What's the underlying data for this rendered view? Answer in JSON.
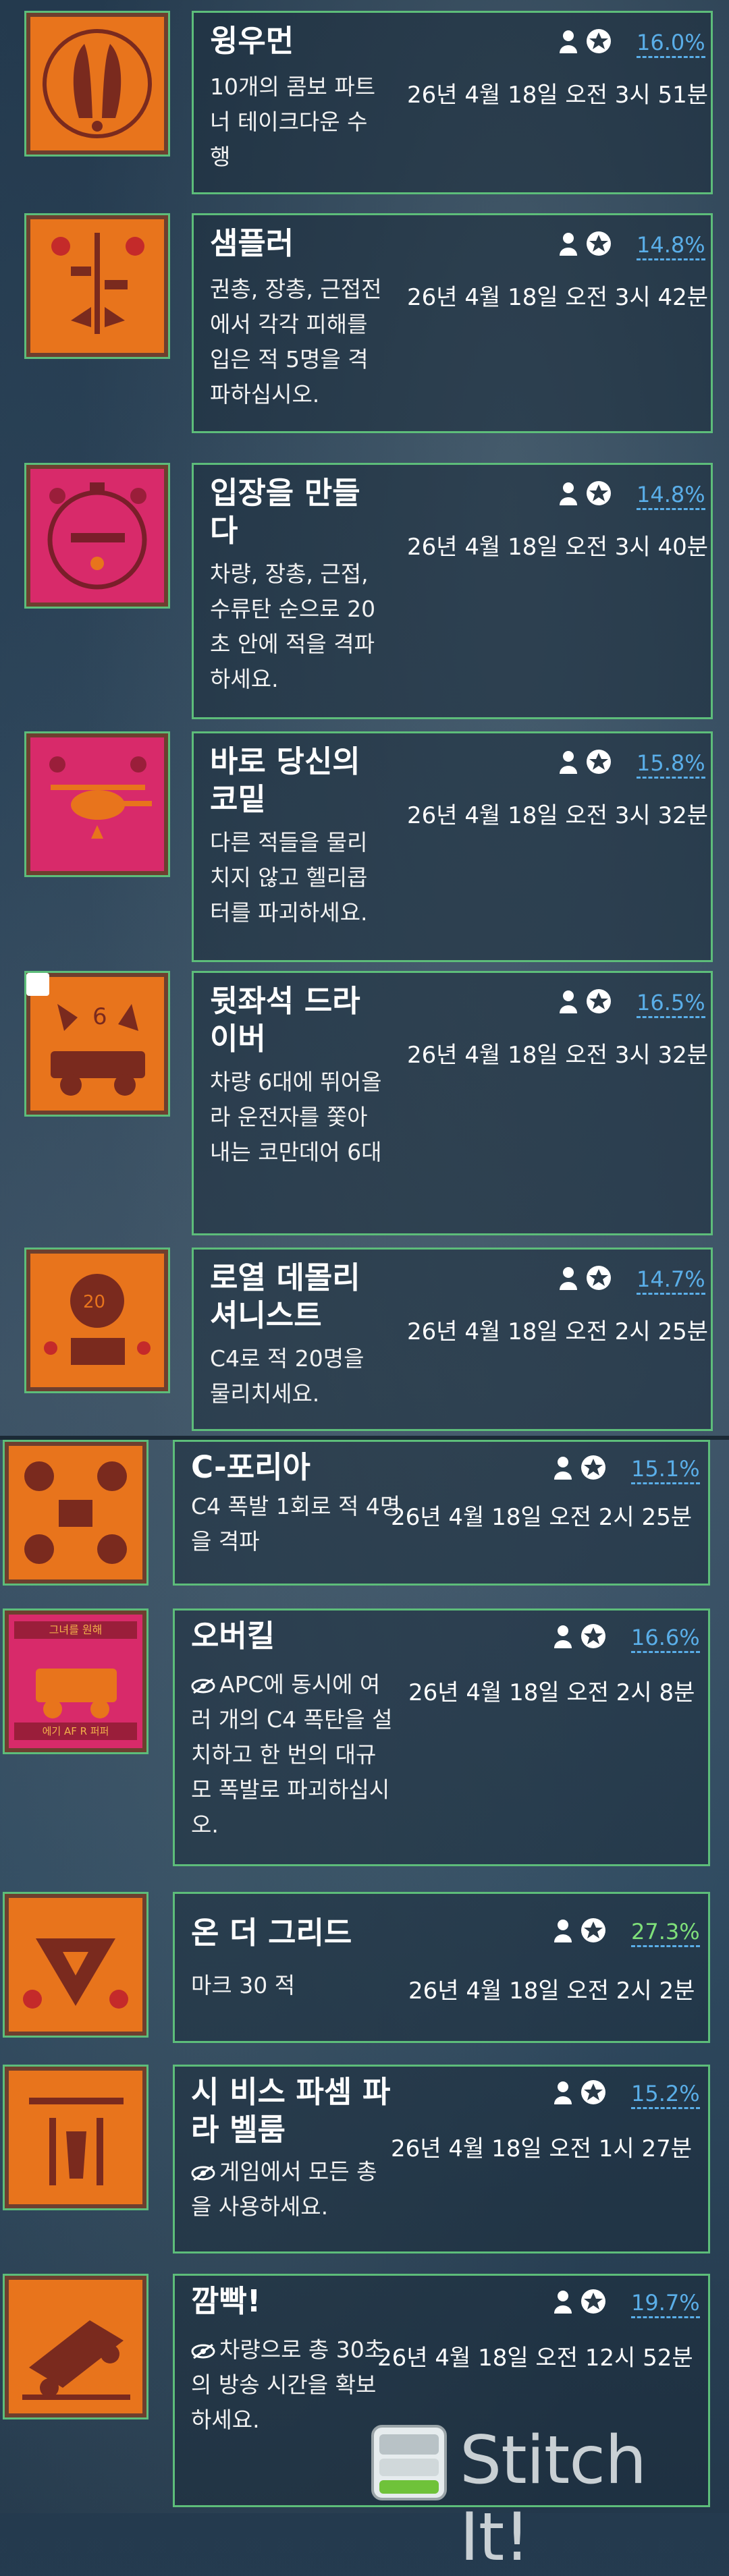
{
  "achievements": [
    {
      "title": "윙우먼",
      "desc": "10개의 콤보 파트너 테이크다운 수행",
      "date": "26년 4월 18일 오전 3시 51분",
      "pct": "16.0%",
      "thumb_bg": "#e8741c",
      "frame": "#7a4a2a"
    },
    {
      "title": "샘플러",
      "desc": "권총, 장총, 근접전에서 각각 피해를 입은 적 5명을 격파하십시오.",
      "date": "26년 4월 18일 오전 3시 42분",
      "pct": "14.8%",
      "thumb_bg": "#e8741c",
      "frame": "#7a4a2a"
    },
    {
      "title": "입장을 만들다",
      "desc": "차량, 장총, 근접, 수류탄 순으로 20초 안에 적을 격파하세요.",
      "date": "26년 4월 18일 오전 3시 40분",
      "pct": "14.8%",
      "thumb_bg": "#d82a6a",
      "frame": "#7a2a4a"
    },
    {
      "title": "바로 당신의 코밑",
      "desc": "다른 적들을 물리치지 않고 헬리콥터를 파괴하세요.",
      "date": "26년 4월 18일 오전 3시 32분",
      "pct": "15.8%",
      "thumb_bg": "#d82a6a",
      "frame": "#7a2a4a"
    },
    {
      "title": "뒷좌석 드라이버",
      "desc": "차량 6대에 뛰어올라 운전자를 쫓아내는 코만데어 6대",
      "date": "26년 4월 18일 오전 3시 32분",
      "pct": "16.5%",
      "thumb_bg": "#e8741c",
      "frame": "#7a4a2a"
    },
    {
      "title": "로열 데몰리셔니스트",
      "desc": "C4로 적 20명을 물리치세요.",
      "date": "26년 4월 18일 오전 2시 25분",
      "pct": "14.7%",
      "thumb_bg": "#e8741c",
      "frame": "#7a4a2a"
    },
    {
      "title": "C-포리아",
      "desc": "C4 폭발 1회로 적 4명을 격파",
      "date": "26년 4월 18일 오전 2시 25분",
      "pct": "15.1%",
      "thumb_bg": "#e8741c",
      "frame": "#7a4a2a"
    },
    {
      "title": "오버킬",
      "desc": "APC에 동시에 여러 개의 C4 폭탄을 설치하고 한 번의 대규모 폭발로 파괴하십시오.",
      "date": "26년 4월 18일 오전 2시 8분",
      "pct": "16.6%",
      "thumb_bg": "#d82a6a",
      "frame": "#7a2a4a",
      "hidden": true,
      "thumb_banner_top": "그녀를 원해",
      "thumb_banner_bottom": "에기 AF R 퍼퍼"
    },
    {
      "title": "온 더 그리드",
      "desc": "마크 30 적",
      "date": "26년 4월 18일 오전 2시 2분",
      "pct": "27.3%",
      "thumb_bg": "#e8741c",
      "frame": "#7a4a2a",
      "green": true
    },
    {
      "title": "시 비스 파셈 파라 벨룸",
      "desc": "게임에서 모든 총을 사용하세요.",
      "date": "26년 4월 18일 오전 1시 27분",
      "pct": "15.2%",
      "thumb_bg": "#e8741c",
      "frame": "#7a4a2a",
      "hidden": true
    },
    {
      "title": "깜빡!",
      "desc": "차량으로 총 30초의 방송 시간을 확보하세요.",
      "date": "26년 4월 18일 오전 12시 52분",
      "pct": "19.7%",
      "thumb_bg": "#e8741c",
      "frame": "#7a4a2a",
      "hidden": true
    }
  ],
  "watermark": "Stitch It!",
  "colors": {
    "accent_border": "#5dbd7a",
    "pct_blue": "#5aaee8",
    "pct_green": "#7fe07a"
  }
}
